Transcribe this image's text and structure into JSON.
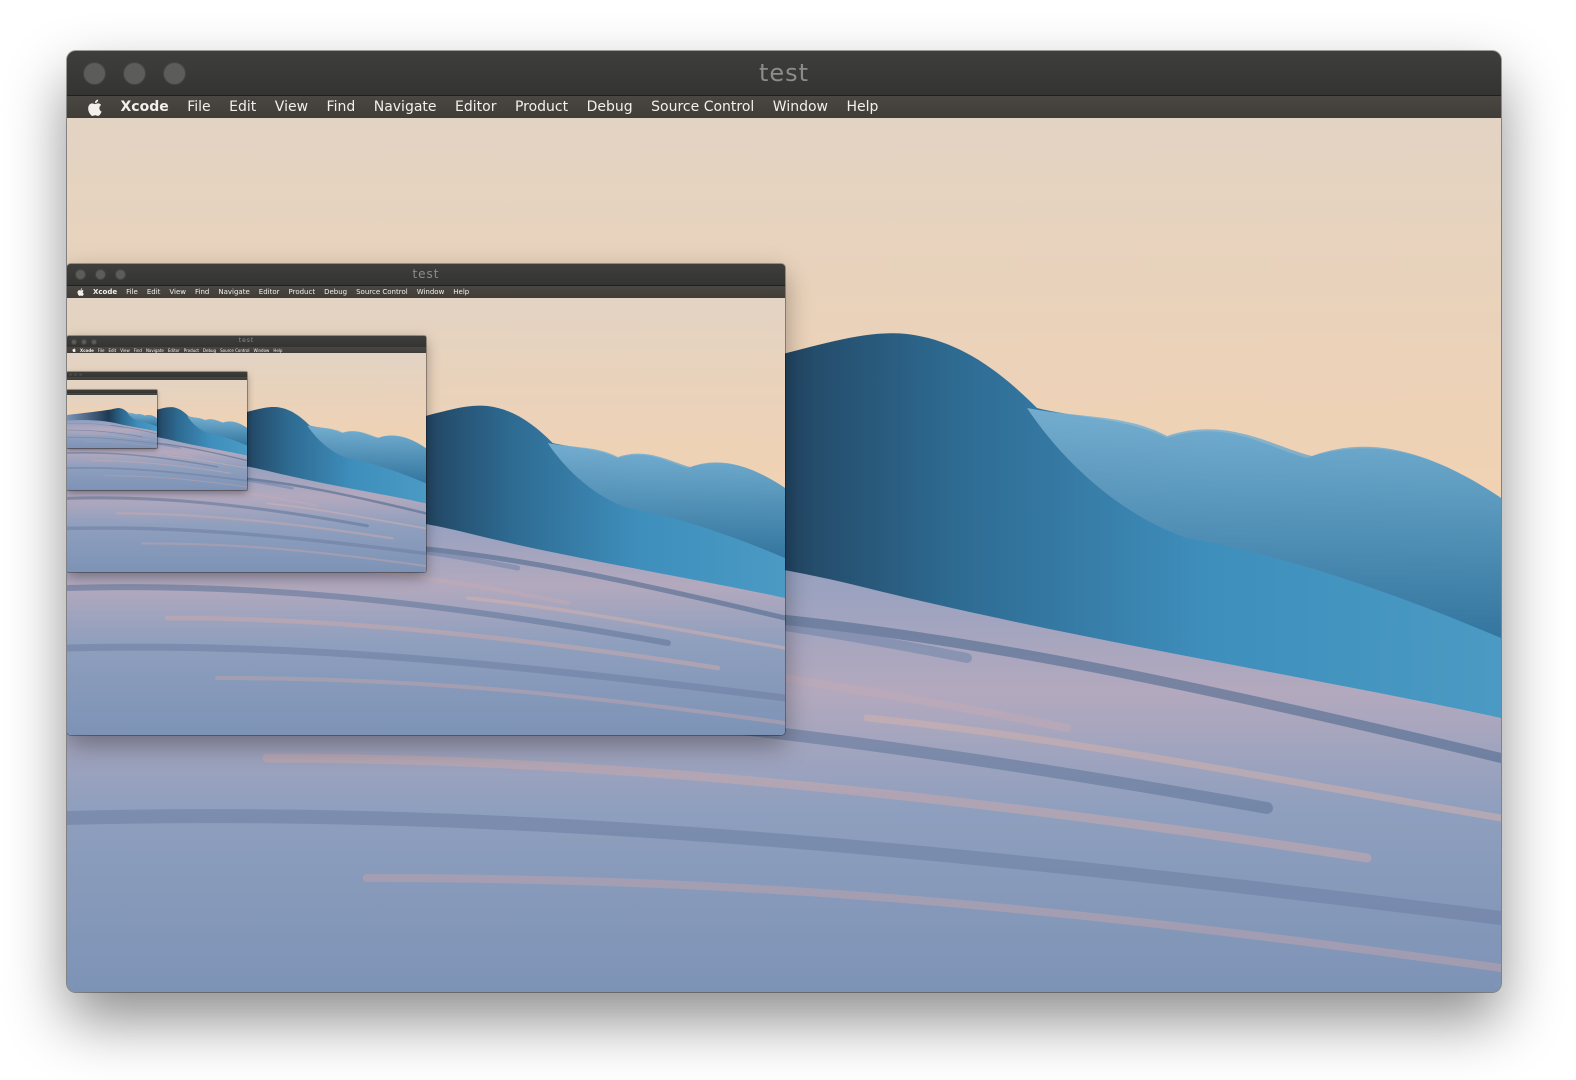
{
  "window": {
    "title": "test"
  },
  "menubar": {
    "apple_icon": "apple-icon",
    "items": [
      "Xcode",
      "File",
      "Edit",
      "View",
      "Find",
      "Navigate",
      "Editor",
      "Product",
      "Debug",
      "Source Control",
      "Window",
      "Help"
    ]
  },
  "desktop": {
    "wallpaper": "ocean-wave",
    "colors": {
      "sky": "#efd3b8",
      "wave_dark": "#1f3c55",
      "wave_light": "#4b95c2",
      "water": "#8798b8"
    }
  }
}
